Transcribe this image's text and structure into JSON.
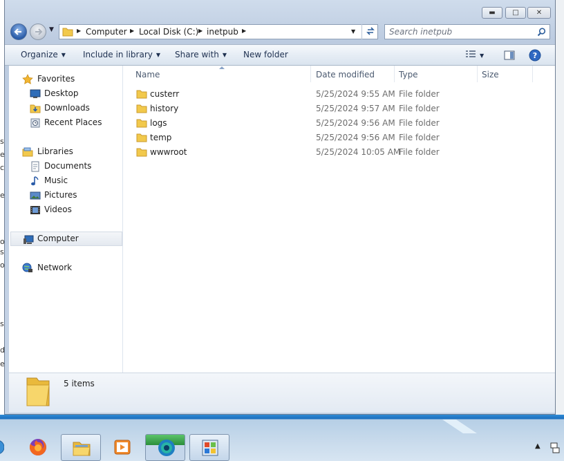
{
  "address": {
    "crumbs": [
      "Computer",
      "Local Disk (C:)",
      "inetpub"
    ]
  },
  "search": {
    "placeholder": "Search inetpub"
  },
  "toolbar": {
    "organize": "Organize",
    "include_in_library": "Include in library",
    "share_with": "Share with",
    "new_folder": "New folder"
  },
  "navpane": {
    "favorites": "Favorites",
    "desktop": "Desktop",
    "downloads": "Downloads",
    "recent_places": "Recent Places",
    "libraries": "Libraries",
    "documents": "Documents",
    "music": "Music",
    "pictures": "Pictures",
    "videos": "Videos",
    "computer": "Computer",
    "network": "Network"
  },
  "columns": {
    "name": "Name",
    "date_modified": "Date modified",
    "type": "Type",
    "size": "Size"
  },
  "files": [
    {
      "name": "custerr",
      "date": "5/25/2024 9:55 AM",
      "type": "File folder"
    },
    {
      "name": "history",
      "date": "5/25/2024 9:57 AM",
      "type": "File folder"
    },
    {
      "name": "logs",
      "date": "5/25/2024 9:56 AM",
      "type": "File folder"
    },
    {
      "name": "temp",
      "date": "5/25/2024 9:56 AM",
      "type": "File folder"
    },
    {
      "name": "wwwroot",
      "date": "5/25/2024 10:05 AM",
      "type": "File folder"
    }
  ],
  "details": {
    "item_count": "5 items"
  },
  "taskbar": {
    "apps": [
      "firefox-icon",
      "explorer-icon",
      "media-player-icon",
      "screen-recorder-icon",
      "network-tool-icon"
    ]
  },
  "colors": {
    "folder": "#f2c94c",
    "window_frame": "#c7d5e7",
    "taskbar": "#1b6fbf"
  }
}
